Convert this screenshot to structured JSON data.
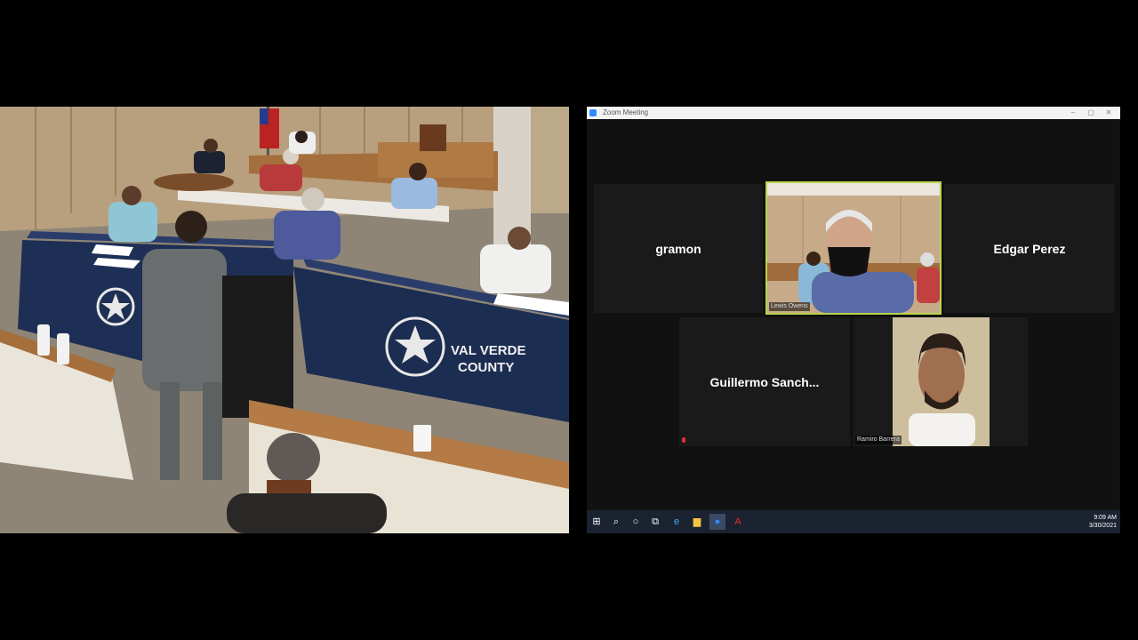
{
  "zoom_window": {
    "title": "Zoom Meeting",
    "controls": [
      "–",
      "▢",
      "✕"
    ]
  },
  "participants": [
    {
      "id": "gramon",
      "name": "gramon",
      "video": false
    },
    {
      "id": "active",
      "name": "Lewis Owens",
      "video": true,
      "highlighted": true
    },
    {
      "id": "edgar",
      "name": "Edgar Perez",
      "video": false
    },
    {
      "id": "guillermo",
      "name": "Guillermo  Sanch...",
      "video": false
    },
    {
      "id": "ramiro",
      "name": "Ramiro Barrera",
      "video": true
    }
  ],
  "room": {
    "table_banner_line1": "VAL VERDE",
    "table_banner_line2": "COUNTY"
  },
  "taskbar": {
    "icons": [
      "windows-icon",
      "search-icon",
      "cortana-icon",
      "task-view-icon",
      "edge-icon",
      "file-explorer-icon",
      "zoom-icon",
      "acrobat-icon"
    ],
    "time": "9:09 AM",
    "date": "3/30/2021"
  },
  "colors": {
    "zoom_bg": "#111111",
    "tile_bg": "#1a1a1a",
    "active_speaker_border": "#b9d44a",
    "taskbar_bg": "#1b2330",
    "table_cloth": "#1e2f55"
  }
}
